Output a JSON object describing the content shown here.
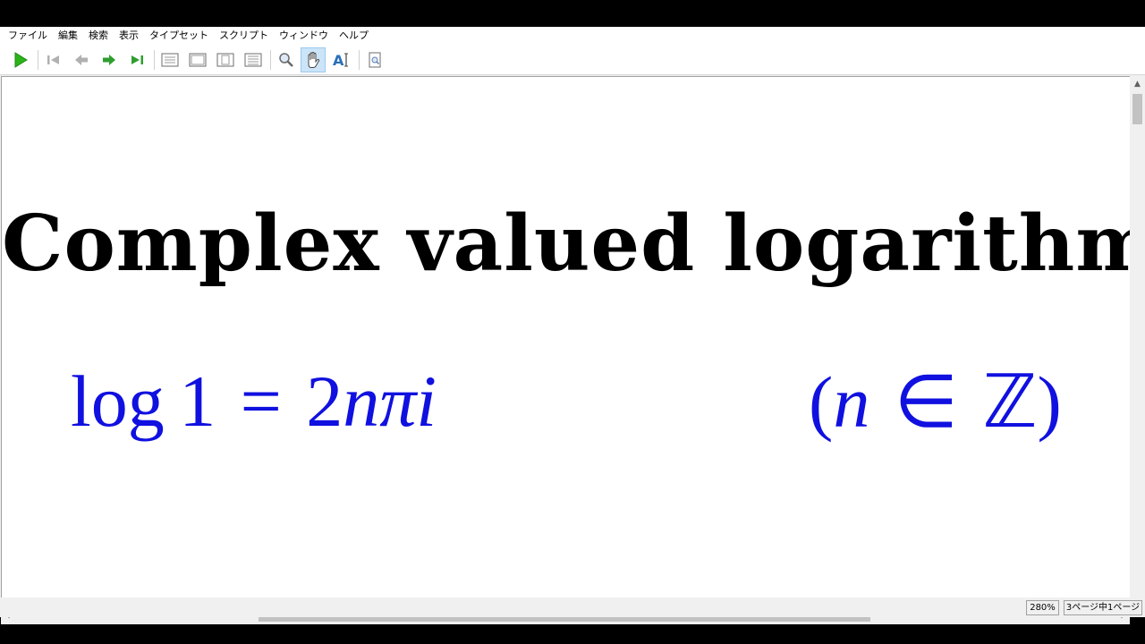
{
  "menu": [
    "ファイル",
    "編集",
    "検索",
    "表示",
    "タイプセット",
    "スクリプト",
    "ウィンドウ",
    "ヘルプ"
  ],
  "toolbar": {
    "icons": [
      "typeset-play-icon",
      "first-page-icon",
      "prev-page-icon",
      "next-page-icon",
      "last-page-icon",
      "view-full-icon",
      "view-width-icon",
      "view-page-icon",
      "view-continuous-icon",
      "magnify-icon",
      "hand-icon",
      "text-select-icon",
      "search-pdf-icon"
    ],
    "active": "hand-icon"
  },
  "document": {
    "title": "Complex valued logarithm",
    "formula": {
      "func": "log",
      "arg": "1",
      "op": "=",
      "coef": "2",
      "n": "n",
      "pi": "π",
      "i": "i"
    },
    "condition": {
      "open": "(",
      "n": "n",
      "in": "∈",
      "set": "ℤ",
      "close": ")"
    }
  },
  "status": {
    "zoom": "280%",
    "page": "3ページ中1ページ"
  },
  "colors": {
    "formula": "#1010e0",
    "play": "#2bb31a",
    "nav": "#2f9e2f"
  }
}
